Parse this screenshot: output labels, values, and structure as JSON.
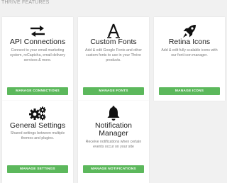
{
  "section": {
    "title": "THRIVE FEATURES"
  },
  "cards": [
    {
      "icon": "arrows-exchange-icon",
      "title": "API Connections",
      "description": "Connect to your email marketing system, reCaptcha, email delivery services & more.",
      "button": "MANAGE CONNECTIONS"
    },
    {
      "icon": "font-a-icon",
      "title": "Custom Fonts",
      "description": "Add & edit Google Fonts and other custom fonts to use in your Thrive products.",
      "button": "MANAGE FONTS"
    },
    {
      "icon": "rocket-icon",
      "title": "Retina Icons",
      "description": "Add & edit fully scalable icons with our font icon manager.",
      "button": "MANAGE ICONS"
    },
    {
      "icon": "gears-icon",
      "title": "General Settings",
      "description": "Shared settings between multiple themes and plugins.",
      "button": "MANAGE SETTINGS"
    },
    {
      "icon": "bell-icon",
      "title_line1": "Notification",
      "title_line2": "Manager",
      "description": "Receive notifications when certain events occur on your site",
      "button": "MANAGE NOTIFICATIONS"
    }
  ],
  "colors": {
    "button": "#5cb85c",
    "background": "#f1f1f1",
    "card": "#ffffff"
  }
}
